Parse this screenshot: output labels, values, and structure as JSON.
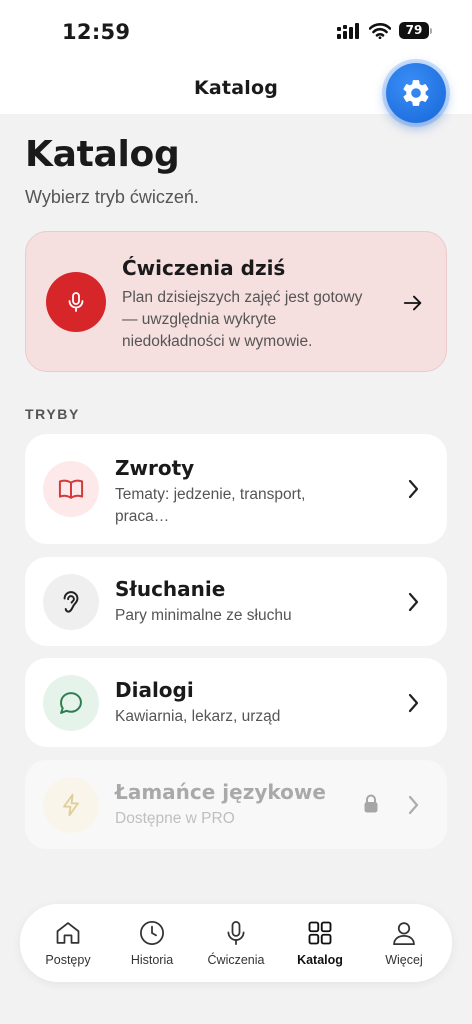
{
  "status_bar": {
    "time": "12:59",
    "battery": "79"
  },
  "nav": {
    "title": "Katalog"
  },
  "header": {
    "title": "Katalog",
    "subtitle": "Wybierz tryb ćwiczeń."
  },
  "today_card": {
    "title": "Ćwiczenia dziś",
    "description": "Plan dzisiejszych zajęć jest gotowy — uwzględnia wykryte niedokładności w wymowie.",
    "icon": "microphone-icon"
  },
  "section": {
    "label": "TRYBY"
  },
  "modes": [
    {
      "title": "Zwroty",
      "description": "Tematy: jedzenie, transport, praca…",
      "icon": "book-icon",
      "locked": false
    },
    {
      "title": "Słuchanie",
      "description": "Pary minimalne ze słuchu",
      "icon": "ear-icon",
      "locked": false
    },
    {
      "title": "Dialogi",
      "description": "Kawiarnia, lekarz, urząd",
      "icon": "chat-bubble-icon",
      "locked": false
    },
    {
      "title": "Łamańce językowe",
      "description": "Dostępne w PRO",
      "icon": "lightning-icon",
      "locked": true
    }
  ],
  "tabs": [
    {
      "label": "Postępy",
      "icon": "home-icon",
      "active": false
    },
    {
      "label": "Historia",
      "icon": "clock-icon",
      "active": false
    },
    {
      "label": "Ćwiczenia",
      "icon": "microphone-icon",
      "active": false
    },
    {
      "label": "Katalog",
      "icon": "grid-icon",
      "active": true
    },
    {
      "label": "Więcej",
      "icon": "person-icon",
      "active": false
    }
  ],
  "colors": {
    "accent": "#1a6fe0",
    "today_card_bg": "#f6dfdf",
    "mic_red": "#d7262a",
    "zwroty_icon_bg": "#fde9e9",
    "sluchanie_icon_bg": "#efefef",
    "dialogi_icon_bg": "#e5f3ea",
    "lamance_icon_bg": "#faf3df"
  }
}
